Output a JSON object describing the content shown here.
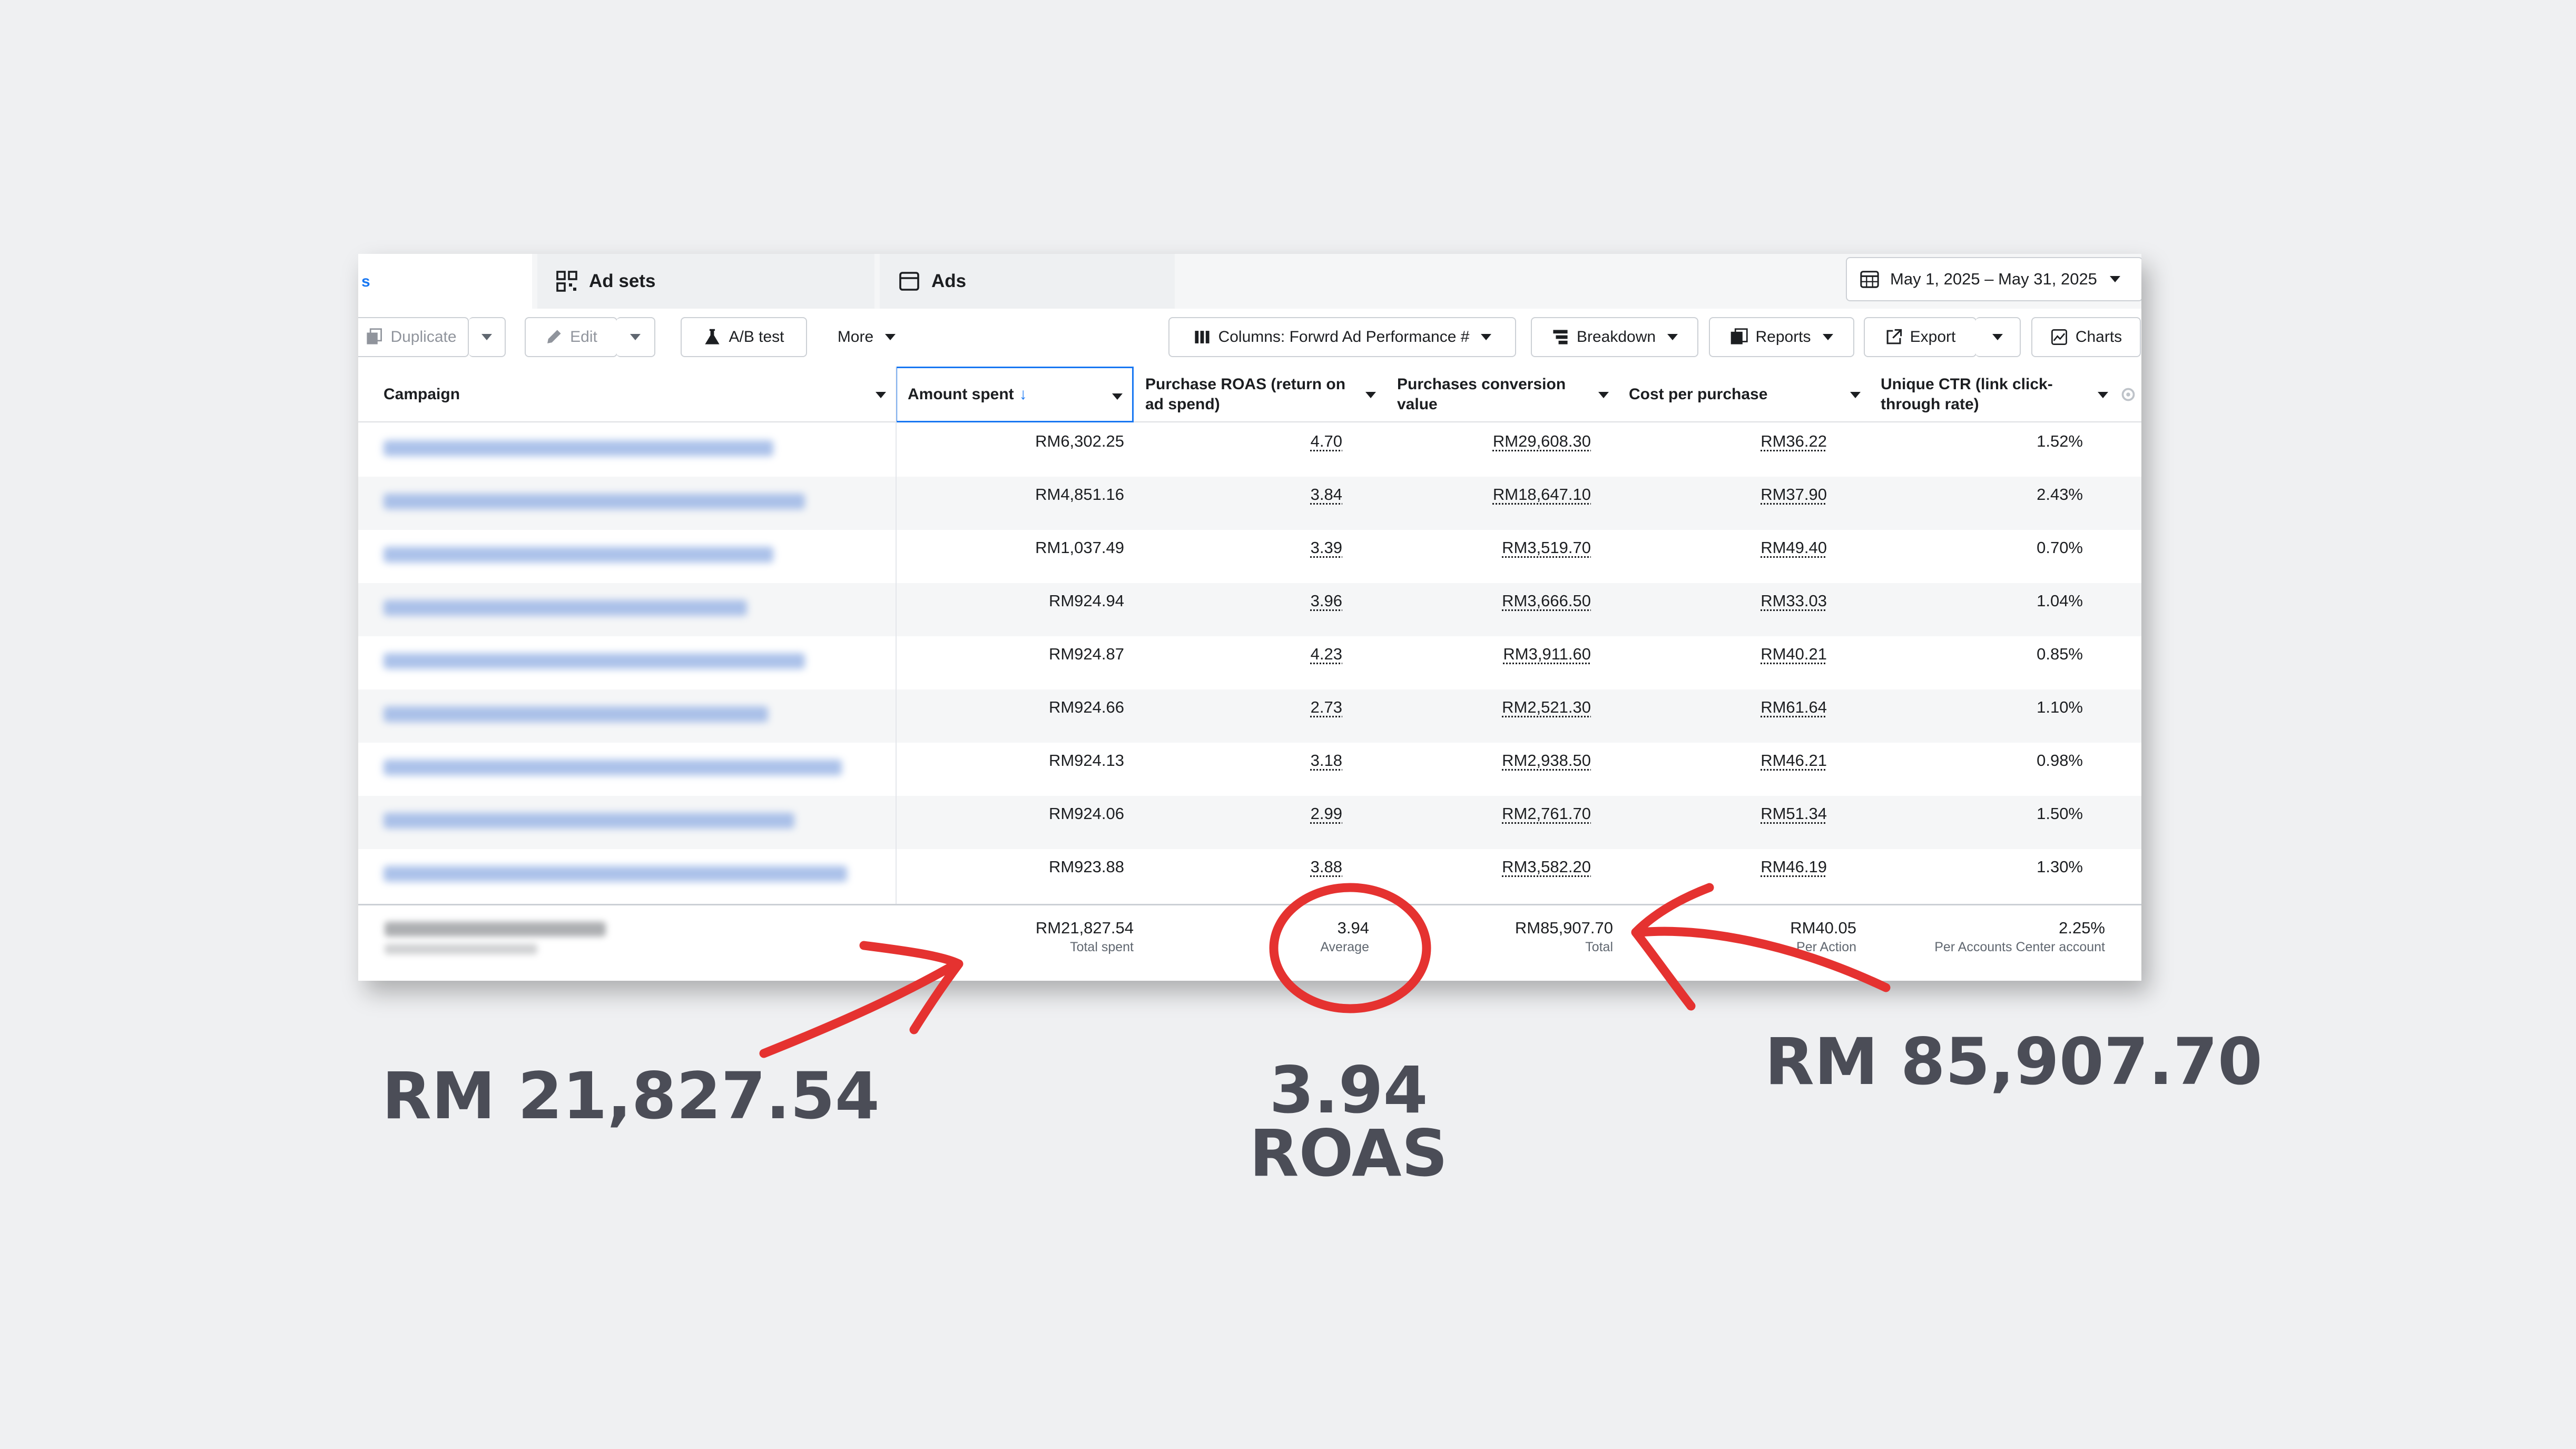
{
  "tabs": {
    "active_partial": "s",
    "ad_sets": "Ad sets",
    "ads": "Ads"
  },
  "date_range": "May 1, 2025 – May 31, 2025",
  "toolbar": {
    "duplicate": "Duplicate",
    "edit": "Edit",
    "ab_test": "A/B test",
    "more": "More",
    "columns": "Columns: Forwrd Ad Performance #",
    "breakdown": "Breakdown",
    "reports": "Reports",
    "export": "Export",
    "charts": "Charts"
  },
  "columns": {
    "campaign": "Campaign",
    "amount_spent": "Amount spent",
    "roas_line1": "Purchase ROAS (return on",
    "roas_line2": "ad spend)",
    "conv_value_line1": "Purchases conversion",
    "conv_value_line2": "value",
    "cost_per_purchase": "Cost per purchase",
    "ctr_line1": "Unique CTR (link click-",
    "ctr_line2": "through rate)"
  },
  "rows": [
    {
      "spent": "RM6,302.25",
      "roas": "4.70",
      "value": "RM29,608.30",
      "cpp": "RM36.22",
      "ctr": "1.52%"
    },
    {
      "spent": "RM4,851.16",
      "roas": "3.84",
      "value": "RM18,647.10",
      "cpp": "RM37.90",
      "ctr": "2.43%"
    },
    {
      "spent": "RM1,037.49",
      "roas": "3.39",
      "value": "RM3,519.70",
      "cpp": "RM49.40",
      "ctr": "0.70%"
    },
    {
      "spent": "RM924.94",
      "roas": "3.96",
      "value": "RM3,666.50",
      "cpp": "RM33.03",
      "ctr": "1.04%"
    },
    {
      "spent": "RM924.87",
      "roas": "4.23",
      "value": "RM3,911.60",
      "cpp": "RM40.21",
      "ctr": "0.85%"
    },
    {
      "spent": "RM924.66",
      "roas": "2.73",
      "value": "RM2,521.30",
      "cpp": "RM61.64",
      "ctr": "1.10%"
    },
    {
      "spent": "RM924.13",
      "roas": "3.18",
      "value": "RM2,938.50",
      "cpp": "RM46.21",
      "ctr": "0.98%"
    },
    {
      "spent": "RM924.06",
      "roas": "2.99",
      "value": "RM2,761.70",
      "cpp": "RM51.34",
      "ctr": "1.50%"
    },
    {
      "spent": "RM923.88",
      "roas": "3.88",
      "value": "RM3,582.20",
      "cpp": "RM46.19",
      "ctr": "1.30%"
    }
  ],
  "totals": {
    "spent": "RM21,827.54",
    "spent_label": "Total spent",
    "roas": "3.94",
    "roas_label": "Average",
    "value": "RM85,907.70",
    "value_label": "Total",
    "cpp": "RM40.05",
    "cpp_label": "Per Action",
    "ctr": "2.25%",
    "ctr_label": "Per Accounts Center account"
  },
  "annotations": {
    "spent": "RM 21,827.54",
    "roas_value": "3.94",
    "roas_word": "ROAS",
    "value": "RM 85,907.70"
  },
  "colors": {
    "annotation_red": "#e53230",
    "accent_blue": "#1877f2",
    "big_text": "#4b4d57"
  }
}
